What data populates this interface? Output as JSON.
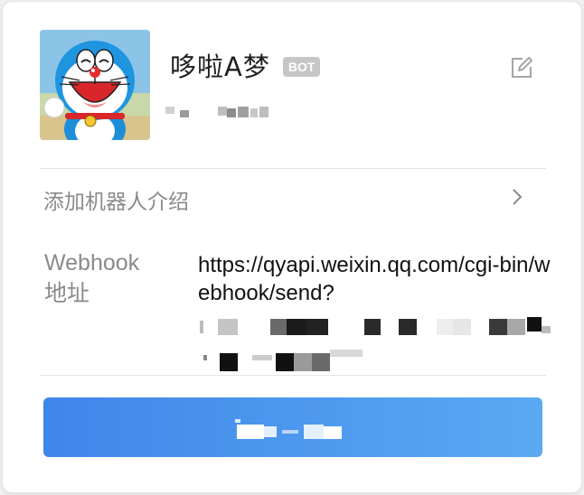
{
  "bot": {
    "name": "哆啦A梦",
    "badge": "BOT"
  },
  "intro": {
    "label": "添加机器人介绍"
  },
  "webhook": {
    "label_line1": "Webhook",
    "label_line2": "地址",
    "url_visible": "https://qyapi.weixin.qq.com/cgi-bin/webhook/send?"
  },
  "icons": {
    "edit": "edit-icon",
    "chevron": "chevron-right-icon"
  },
  "colors": {
    "button_start": "#3f86ea",
    "button_end": "#5aa9f2",
    "badge_bg": "#c6c6c6",
    "muted_text": "#8a8a8a"
  }
}
